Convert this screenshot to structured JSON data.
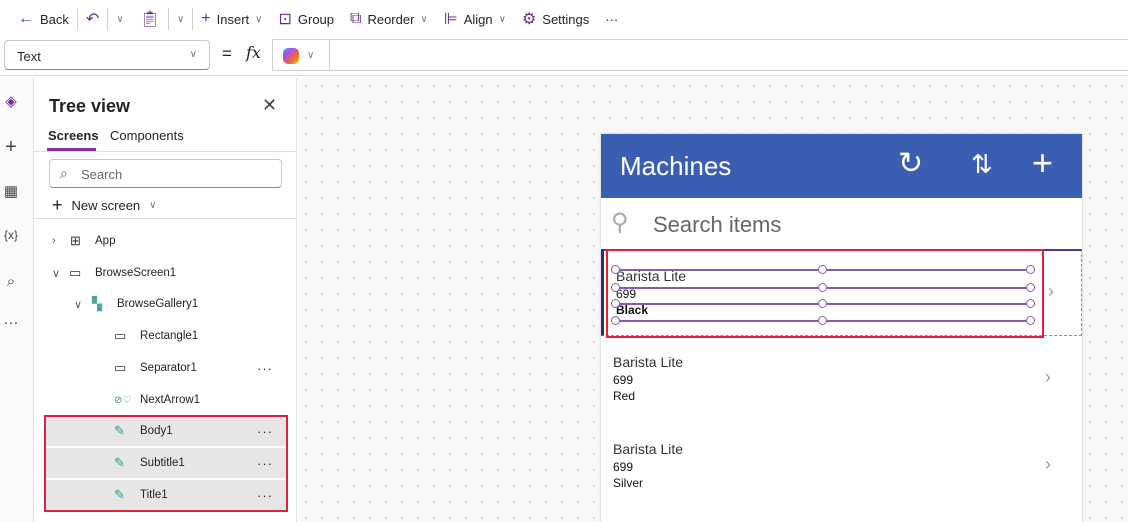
{
  "toolbar": {
    "back": "Back",
    "insert": "Insert",
    "group": "Group",
    "reorder": "Reorder",
    "align": "Align",
    "settings": "Settings",
    "more": "···"
  },
  "formula": {
    "property": "Text",
    "equals": "=",
    "fx": "fx",
    "value": ""
  },
  "tree": {
    "title": "Tree view",
    "tabs": [
      "Screens",
      "Components"
    ],
    "search_placeholder": "Search",
    "new_screen": "New screen",
    "nodes": [
      {
        "label": "App"
      },
      {
        "label": "BrowseScreen1"
      },
      {
        "label": "BrowseGallery1"
      },
      {
        "label": "Rectangle1"
      },
      {
        "label": "Separator1"
      },
      {
        "label": "NextArrow1"
      },
      {
        "label": "Body1"
      },
      {
        "label": "Subtitle1"
      },
      {
        "label": "Title1"
      }
    ]
  },
  "app": {
    "title": "Machines",
    "search_placeholder": "Search items",
    "items": [
      {
        "title": "Barista Lite",
        "price": "699",
        "color": "Black"
      },
      {
        "title": "Barista Lite",
        "price": "699",
        "color": "Red"
      },
      {
        "title": "Barista Lite",
        "price": "699",
        "color": "Silver"
      }
    ]
  },
  "colors": {
    "accent": "#8a2a9f",
    "header": "#3a5fb2",
    "selection": "#e0203c"
  }
}
